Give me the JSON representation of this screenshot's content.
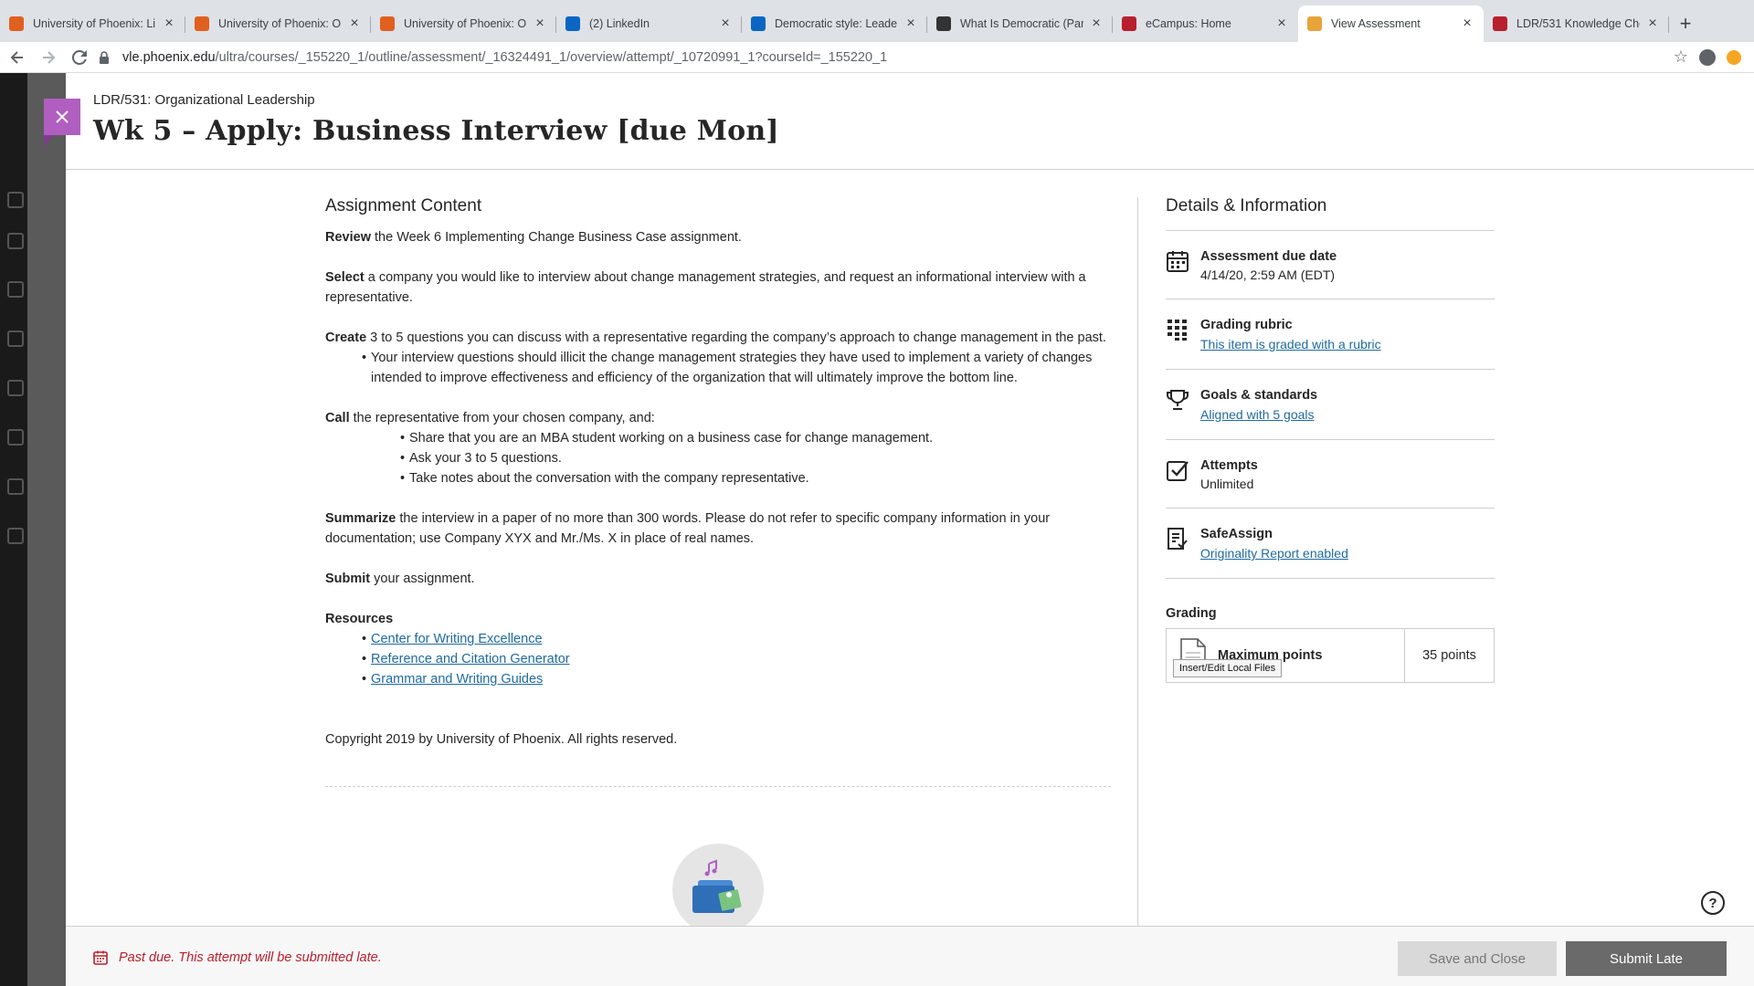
{
  "browser": {
    "tabs": [
      {
        "title": "University of Phoenix: Li",
        "favicon_color": "#e06020",
        "active": false
      },
      {
        "title": "University of Phoenix: O",
        "favicon_color": "#e06020",
        "active": false
      },
      {
        "title": "University of Phoenix: O",
        "favicon_color": "#e06020",
        "active": false
      },
      {
        "title": "(2) LinkedIn",
        "favicon_color": "#0a66c2",
        "active": false
      },
      {
        "title": "Democratic style: Leade",
        "favicon_color": "#0a66c2",
        "active": false
      },
      {
        "title": "What Is Democratic (Par",
        "favicon_color": "#333333",
        "active": false
      },
      {
        "title": "eCampus: Home",
        "favicon_color": "#b8202d",
        "active": false
      },
      {
        "title": "View Assessment",
        "favicon_color": "#e8a33a",
        "active": true
      },
      {
        "title": "LDR/531 Knowledge Che",
        "favicon_color": "#b8202d",
        "active": false
      }
    ],
    "url_host": "vle.phoenix.edu",
    "url_path": "/ultra/courses/_155220_1/outline/assessment/_16324491_1/overview/attempt/_10720991_1?courseId=_155220_1"
  },
  "header": {
    "course": "LDR/531: Organizational Leadership",
    "title": "Wk 5 – Apply: Business Interview [due Mon]"
  },
  "content": {
    "heading": "Assignment Content",
    "review": {
      "bold": "Review",
      "text": " the Week 6 Implementing Change Business Case assignment."
    },
    "select": {
      "bold": "Select",
      "text": " a company you would like to interview about change management strategies, and request an informational interview with a representative."
    },
    "create": {
      "bold": "Create",
      "text": " 3 to 5 questions you can discuss with a representative regarding the company’s approach to change management in the past."
    },
    "create_bullets": [
      "Your interview questions should illicit the change management strategies they have used to implement a variety of changes intended to improve effectiveness and efficiency of the organization that will ultimately improve the bottom line."
    ],
    "call": {
      "bold": "Call",
      "text": " the representative from your chosen company, and:"
    },
    "call_bullets": [
      "Share that you are an MBA student working on a business case for change management.",
      "Ask your 3 to 5 questions.",
      "Take notes about the conversation with the company representative."
    ],
    "summarize": {
      "bold": "Summarize",
      "text": " the interview in a paper of no more than 300 words. Please do not refer to specific company information in your documentation; use Company XYX and Mr./Ms. X in place of real names."
    },
    "submit": {
      "bold": "Submit",
      "text": " your assignment."
    },
    "resources_heading": "Resources",
    "resources": [
      "Center for Writing Excellence",
      "Reference and Citation Generator",
      "Grammar and Writing Guides"
    ],
    "copyright": "Copyright 2019 by University of Phoenix. All rights reserved."
  },
  "details": {
    "heading": "Details & Information",
    "due_label": "Assessment due date",
    "due_value": "4/14/20, 2:59 AM (EDT)",
    "rubric_label": "Grading rubric",
    "rubric_link": "This item is graded with a rubric",
    "goals_label": "Goals & standards",
    "goals_link": "Aligned with 5 goals",
    "attempts_label": "Attempts",
    "attempts_value": "Unlimited",
    "safeassign_label": "SafeAssign",
    "safeassign_link": "Originality Report enabled",
    "grading_heading": "Grading",
    "max_points_label": "Maximum points",
    "max_points_value": "35 points",
    "tooltip": "Insert/Edit Local Files"
  },
  "footer": {
    "late_message": "Past due. This attempt will be submitted late.",
    "save_label": "Save and Close",
    "submit_label": "Submit Late"
  },
  "colors": {
    "accent": "#b05ec0",
    "link": "#1f6a9e",
    "danger": "#b8202d",
    "submit_button": "#6a6a6a"
  }
}
